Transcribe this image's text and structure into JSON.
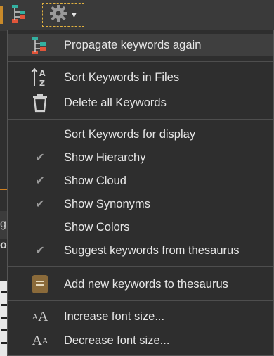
{
  "menu": {
    "items": [
      {
        "id": "propagate",
        "label": "Propagate keywords again",
        "icon": "hierarchy-down-icon",
        "checked": false
      },
      {
        "id": "sort-files",
        "label": "Sort Keywords in Files",
        "icon": "sort-az-icon",
        "checked": false
      },
      {
        "id": "delete-all",
        "label": "Delete all Keywords",
        "icon": "trash-icon",
        "checked": false
      },
      {
        "id": "sort-display",
        "label": "Sort Keywords for display",
        "icon": "",
        "checked": false
      },
      {
        "id": "show-hierarchy",
        "label": "Show Hierarchy",
        "icon": "checkmark-icon",
        "checked": true
      },
      {
        "id": "show-cloud",
        "label": "Show Cloud",
        "icon": "checkmark-icon",
        "checked": true
      },
      {
        "id": "show-synonyms",
        "label": "Show Synonyms",
        "icon": "checkmark-icon",
        "checked": true
      },
      {
        "id": "show-colors",
        "label": "Show Colors",
        "icon": "",
        "checked": false
      },
      {
        "id": "suggest-thesaurus",
        "label": "Suggest keywords from thesaurus",
        "icon": "checkmark-icon",
        "checked": true
      },
      {
        "id": "add-thesaurus",
        "label": "Add new keywords to thesaurus",
        "icon": "book-icon",
        "checked": false
      },
      {
        "id": "increase-font",
        "label": "Increase font size...",
        "icon": "font-increase-icon",
        "checked": false
      },
      {
        "id": "decrease-font",
        "label": "Decrease font size...",
        "icon": "font-decrease-icon",
        "checked": false
      }
    ]
  },
  "toolbar": {
    "buttons": [
      "hierarchy-down-icon",
      "settings-gear-icon"
    ],
    "dropdown_arrow": "▼"
  },
  "glyphs": {
    "check": "✔",
    "font_small_a": "A",
    "font_large_a": "A"
  },
  "background": {
    "fragment_1": "g",
    "fragment_2": "ol"
  },
  "colors": {
    "menu_bg": "#2e2e2e",
    "highlight_bg": "#3f3f3f",
    "text": "#e6e6e6",
    "accent_orange": "#d08020"
  }
}
